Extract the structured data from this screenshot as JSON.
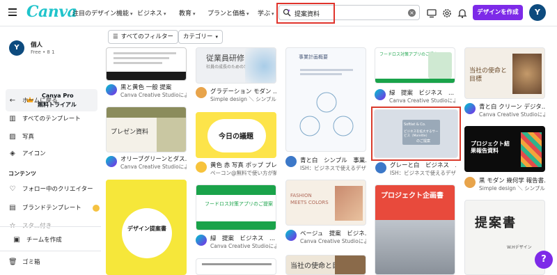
{
  "header": {
    "logo": "Canva",
    "nav": [
      {
        "label": "注目のデザイン機能"
      },
      {
        "label": "ビジネス"
      },
      {
        "label": "教育"
      },
      {
        "label": "プランと価格"
      },
      {
        "label": "学ぶ"
      }
    ],
    "search_value": "提案資料",
    "create_button": "デザインを作成",
    "avatar_initial": "Y"
  },
  "sidebar": {
    "user_initial": "Y",
    "user_name": "個人",
    "user_plan": "Free • 8 1",
    "pro_line1": "Canva Pro",
    "pro_line2": "無料トライアル",
    "items": [
      {
        "label": "ホームに戻る",
        "icon": "arrow-left-icon"
      },
      {
        "label": "すべてのテンプレート",
        "icon": "template-icon"
      },
      {
        "label": "写真",
        "icon": "photo-icon"
      },
      {
        "label": "アイコン",
        "icon": "shapes-icon"
      }
    ],
    "section_title": "コンテンツ",
    "content_items": [
      {
        "label": "フォロー中のクリエイター",
        "icon": "heart-icon"
      },
      {
        "label": "ブランドテンプレート",
        "icon": "brand-icon"
      },
      {
        "label": "スタ...付き",
        "icon": "star-icon"
      }
    ],
    "team_button": "チームを作成",
    "trash": "ゴミ箱"
  },
  "filters": {
    "all_filters": "すべてのフィルター",
    "category": "カテゴリー"
  },
  "cards": [
    {
      "title": "黒と黄色 一般 提案",
      "subtitle": "Canva Creative Studioによ..."
    },
    {
      "title": "グラデーション モダン ...",
      "subtitle": "Simple design ＼ シンプルで..."
    },
    {
      "title": "",
      "subtitle": ""
    },
    {
      "title": "緑　提案　ビジネス　...",
      "subtitle": "Canva Creative Studioによ..."
    },
    {
      "title": "青と白 クリーン デジタ...",
      "subtitle": "Canva Creative Studioによ..."
    },
    {
      "title": "オリーブグリーンとダス...",
      "subtitle": "Canva Creative Studioによ..."
    },
    {
      "title": "黄色 赤 写真 ポップ プレ...",
      "subtitle": "ペーコン@無料で使い方が解..."
    },
    {
      "title": "青と白　シンプル　事業...",
      "subtitle": "ISH：ビジネスで使えるデザ..."
    },
    {
      "title": "グレーと白　ビジネス　...",
      "subtitle": "ISH：ビジネスで使えるデザ..."
    },
    {
      "title": "黒 モダン 幾何学 報告書...",
      "subtitle": "Simple design ＼ シンプルで..."
    },
    {
      "title": "緑　提案　ビジネス　...",
      "subtitle": "Canva Creative Studioによ..."
    },
    {
      "title": "ベージュ　提案　ビジネ...",
      "subtitle": "Canva Creative Studioによ..."
    }
  ],
  "thumb_text": {
    "t2_title": "従業員研修",
    "t2_sub": "社員の成長のための手引き",
    "t3_title": "事業計画概要",
    "t6_title": "プレゼン資料",
    "t7_title": "今日の議題",
    "t9_line1": "Softlat & Co.",
    "t9_line2": "ビジネスを拡大するサービス（Moreltle）",
    "t9_line3": "のご提案",
    "t5_title": "当社の使命と目標",
    "t10_title": "プロジェクト結果報告資料",
    "t11_title": "フードロス対策アプリのご提案",
    "t12_title": "FASHION MEETS COLORS",
    "t13_title": "プロジェクト企画書",
    "t14_title": "提案書",
    "t14_sub": "W.Hデザイン",
    "t15_title": "デザイン提案書",
    "t16_title": "当社の使命と目標",
    "t4_title": "フードロス対策アプリのご提案"
  },
  "colors": {
    "brand": "#7d2ae8",
    "logo": "#20c4cb",
    "highlight": "#e0332b"
  }
}
